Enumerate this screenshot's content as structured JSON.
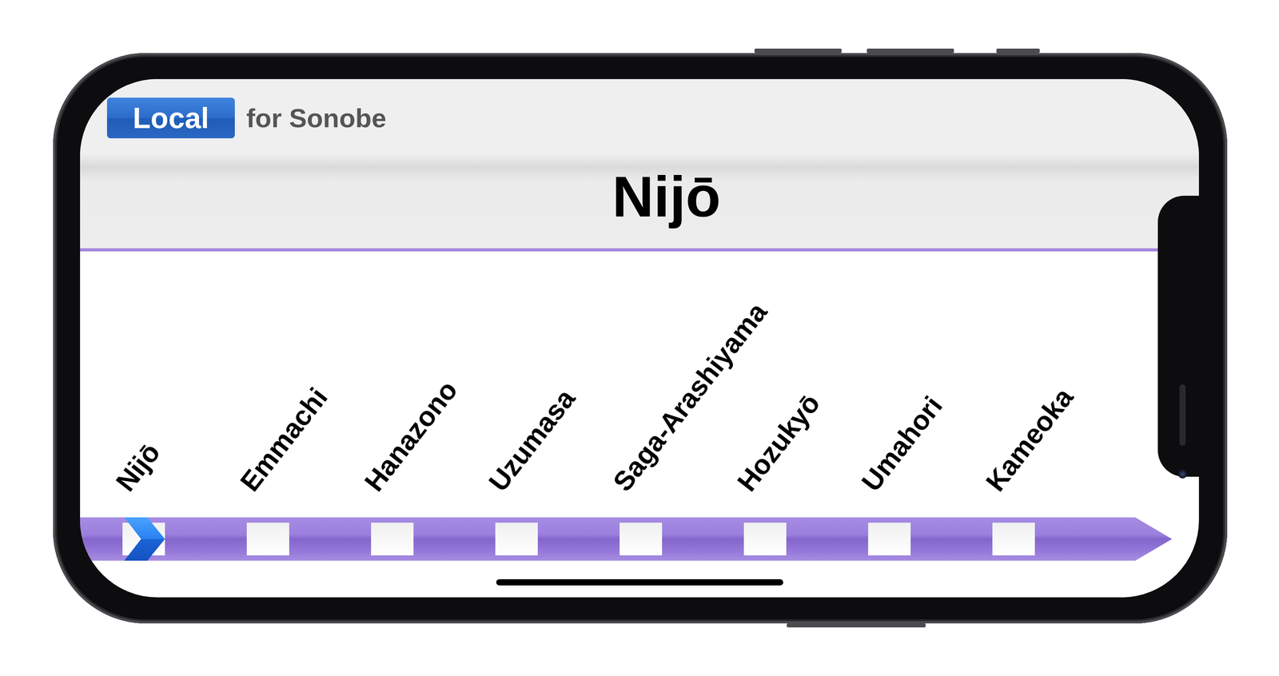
{
  "service": {
    "type": "Local",
    "destination": "for Sonobe"
  },
  "current_station": "Nijō",
  "stations": [
    {
      "name": "Nijō",
      "selected": true
    },
    {
      "name": "Emmachi",
      "selected": false
    },
    {
      "name": "Hanazono",
      "selected": false
    },
    {
      "name": "Uzumasa",
      "selected": false
    },
    {
      "name": "Saga-Arashiyama",
      "selected": false
    },
    {
      "name": "Hozukyō",
      "selected": false
    },
    {
      "name": "Umahori",
      "selected": false
    },
    {
      "name": "Kameoka",
      "selected": false
    }
  ]
}
